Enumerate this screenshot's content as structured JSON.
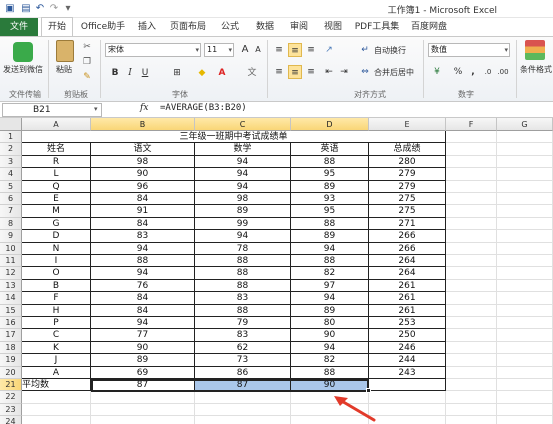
{
  "window": {
    "title": "工作簿1 - Microsoft Excel"
  },
  "tabs": [
    "文件",
    "开始",
    "Office助手",
    "插入",
    "页面布局",
    "公式",
    "数据",
    "审阅",
    "视图",
    "PDF工具集",
    "百度网盘"
  ],
  "ribbon": {
    "send_wechat": "发送到微信",
    "paste": "粘贴",
    "font_name": "宋体",
    "font_size": "11",
    "wrap_text": "自动换行",
    "merge_center": "合并后居中",
    "number_format": "数值",
    "percent": "%",
    "comma": ",",
    "cond_format": "条件格式",
    "group_labels": {
      "file_transfer": "文件传输",
      "clipboard": "剪贴板",
      "font": "字体",
      "alignment": "对齐方式",
      "number": "数字"
    },
    "format_bold": "B",
    "format_italic": "I",
    "format_underline": "U"
  },
  "formula_bar": {
    "name_box": "B21",
    "fx": "fx",
    "formula": "=AVERAGE(B3:B20)"
  },
  "columns": [
    "A",
    "B",
    "C",
    "D",
    "E",
    "F",
    "G"
  ],
  "rows": [
    "1",
    "2",
    "3",
    "4",
    "5",
    "6",
    "7",
    "8",
    "9",
    "10",
    "11",
    "12",
    "13",
    "14",
    "15",
    "16",
    "17",
    "18",
    "19",
    "20",
    "21",
    "22",
    "23",
    "24"
  ],
  "sheet": {
    "title": "三年级一班期中考试成绩单",
    "headers": [
      "姓名",
      "语文",
      "数学",
      "英语",
      "总成绩"
    ],
    "records": [
      [
        "R",
        "98",
        "94",
        "88",
        "280"
      ],
      [
        "L",
        "90",
        "94",
        "95",
        "279"
      ],
      [
        "Q",
        "96",
        "94",
        "89",
        "279"
      ],
      [
        "E",
        "84",
        "98",
        "93",
        "275"
      ],
      [
        "M",
        "91",
        "89",
        "95",
        "275"
      ],
      [
        "G",
        "84",
        "99",
        "88",
        "271"
      ],
      [
        "D",
        "83",
        "94",
        "89",
        "266"
      ],
      [
        "N",
        "94",
        "78",
        "94",
        "266"
      ],
      [
        "I",
        "88",
        "88",
        "88",
        "264"
      ],
      [
        "O",
        "94",
        "88",
        "82",
        "264"
      ],
      [
        "B",
        "76",
        "88",
        "97",
        "261"
      ],
      [
        "F",
        "84",
        "83",
        "94",
        "261"
      ],
      [
        "H",
        "84",
        "88",
        "89",
        "261"
      ],
      [
        "P",
        "94",
        "79",
        "80",
        "253"
      ],
      [
        "C",
        "77",
        "83",
        "90",
        "250"
      ],
      [
        "K",
        "90",
        "62",
        "94",
        "246"
      ],
      [
        "J",
        "89",
        "73",
        "82",
        "244"
      ],
      [
        "A",
        "69",
        "86",
        "88",
        "243"
      ]
    ],
    "average_label": "平均数",
    "averages": [
      "87",
      "87",
      "90"
    ]
  }
}
